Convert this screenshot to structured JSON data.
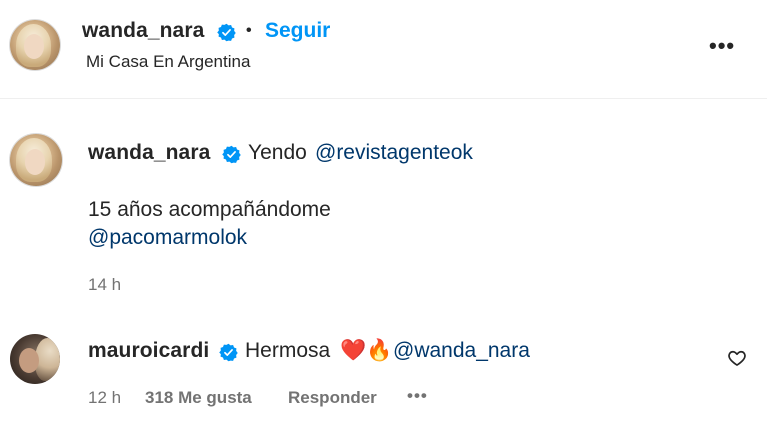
{
  "header": {
    "username": "wanda_nara",
    "separator": "•",
    "follow_label": "Seguir",
    "location": "Mi Casa En Argentina",
    "more_label": "•••"
  },
  "caption": {
    "username": "wanda_nara",
    "text": "Yendo",
    "mention_1": "@revistagenteok",
    "line_2": "15 años acompañándome",
    "mention_2": "@pacomarmolok",
    "time": "14 h"
  },
  "comment": {
    "username": "mauroicardi",
    "text": "Hermosa",
    "emojis": "❤️🔥",
    "mention": "@wanda_nara",
    "time": "12 h",
    "likes": "318 Me gusta",
    "reply_label": "Responder",
    "more_label": "•••"
  },
  "colors": {
    "accent": "#0095f6",
    "mention": "#00376b",
    "verified": "#0095f6",
    "muted": "#737373"
  }
}
